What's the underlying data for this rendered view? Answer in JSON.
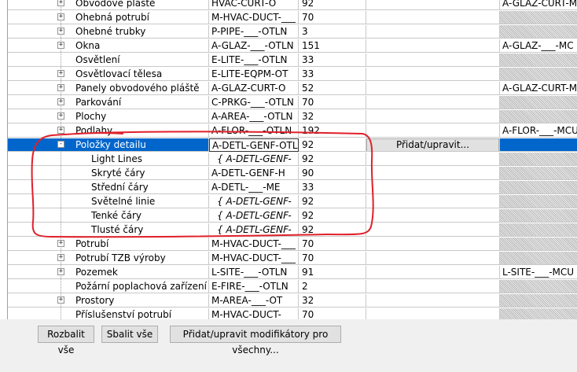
{
  "rows": [
    {
      "name": "Obvodové pláště",
      "pattern": "HVAC-CURT-O",
      "color": "92",
      "modifier": "A-GLAZ-CURT-MC",
      "level": 1,
      "expander": "+"
    },
    {
      "name": "Ohebná potrubí",
      "pattern": "M-HVAC-DUCT-___",
      "color": "70",
      "modifier": "",
      "level": 1,
      "expander": "+"
    },
    {
      "name": "Ohebné trubky",
      "pattern": "P-PIPE-___-OTLN",
      "color": "3",
      "modifier": "",
      "level": 1,
      "expander": "+"
    },
    {
      "name": "Okna",
      "pattern": "A-GLAZ-___-OTLN",
      "color": "151",
      "modifier": "A-GLAZ-___-MC",
      "level": 1,
      "expander": "+"
    },
    {
      "name": "Osvětlení",
      "pattern": "E-LITE-___-OTLN",
      "color": "33",
      "modifier": "",
      "level": 1,
      "expander": ""
    },
    {
      "name": "Osvětlovací tělesa",
      "pattern": "E-LITE-EQPM-OT",
      "color": "33",
      "modifier": "",
      "level": 1,
      "expander": "+"
    },
    {
      "name": "Panely obvodového pláště",
      "pattern": "A-GLAZ-CURT-O",
      "color": "52",
      "modifier": "A-GLAZ-CURT-M",
      "level": 1,
      "expander": "+"
    },
    {
      "name": "Parkování",
      "pattern": "C-PRKG-___-OTLN",
      "color": "70",
      "modifier": "",
      "level": 1,
      "expander": "+"
    },
    {
      "name": "Plochy",
      "pattern": "A-AREA-___-OTLN",
      "color": "32",
      "modifier": "",
      "level": 1,
      "expander": "+"
    },
    {
      "name": "Podlahy",
      "pattern": "A-FLOR-___-OTLN",
      "color": "192",
      "modifier": "A-FLOR-___-MCU",
      "level": 1,
      "expander": "+"
    },
    {
      "name": "Položky detailu",
      "pattern": "A-DETL-GENF-OTL",
      "color": "92",
      "modifier": "",
      "level": 1,
      "expander": "-",
      "selected": true,
      "button": "Přidat/upravit..."
    },
    {
      "name": "Light Lines",
      "pattern": "{ A-DETL-GENF-",
      "color": "92",
      "modifier": "",
      "level": 2,
      "expander": "",
      "italic": true
    },
    {
      "name": "Skryté čáry",
      "pattern": "A-DETL-GENF-H",
      "color": "90",
      "modifier": "",
      "level": 2,
      "expander": ""
    },
    {
      "name": "Střední čáry",
      "pattern": "A-DETL-___-ME",
      "color": "33",
      "modifier": "",
      "level": 2,
      "expander": ""
    },
    {
      "name": "Světelné linie",
      "pattern": "{ A-DETL-GENF-",
      "color": "92",
      "modifier": "",
      "level": 2,
      "expander": "",
      "italic": true
    },
    {
      "name": "Tenké čáry",
      "pattern": "{ A-DETL-GENF-",
      "color": "92",
      "modifier": "",
      "level": 2,
      "expander": "",
      "italic": true
    },
    {
      "name": "Tlusté čáry",
      "pattern": "{ A-DETL-GENF-",
      "color": "92",
      "modifier": "",
      "level": 2,
      "expander": "",
      "italic": true
    },
    {
      "name": "Potrubí",
      "pattern": "M-HVAC-DUCT-___",
      "color": "70",
      "modifier": "",
      "level": 1,
      "expander": "+"
    },
    {
      "name": "Potrubí TZB výroby",
      "pattern": "M-HVAC-DUCT-___",
      "color": "70",
      "modifier": "",
      "level": 1,
      "expander": "+"
    },
    {
      "name": "Pozemek",
      "pattern": "L-SITE-___-OTLN",
      "color": "91",
      "modifier": "L-SITE-___-MCU",
      "level": 1,
      "expander": "+"
    },
    {
      "name": "Požární poplachová zařízení",
      "pattern": "E-FIRE-___-OTLN",
      "color": "2",
      "modifier": "",
      "level": 1,
      "expander": ""
    },
    {
      "name": "Prostory",
      "pattern": "M-AREA-___-OT",
      "color": "32",
      "modifier": "",
      "level": 1,
      "expander": "+"
    },
    {
      "name": "Příslušenství potrubí",
      "pattern": "M-HVAC-DUCT-___",
      "color": "70",
      "modifier": "",
      "level": 1,
      "expander": ""
    },
    {
      "name": "",
      "pattern": "",
      "color": "",
      "modifier": "",
      "level": 1,
      "expander": ""
    }
  ],
  "footer": {
    "expand_all": "Rozbalit vše",
    "collapse_all": "Sbalit vše",
    "edit_all_modifiers": "Přidat/upravit modifikátory pro všechny..."
  },
  "colors": {
    "selection": "#0066cc",
    "annotation": "#e0202a"
  }
}
